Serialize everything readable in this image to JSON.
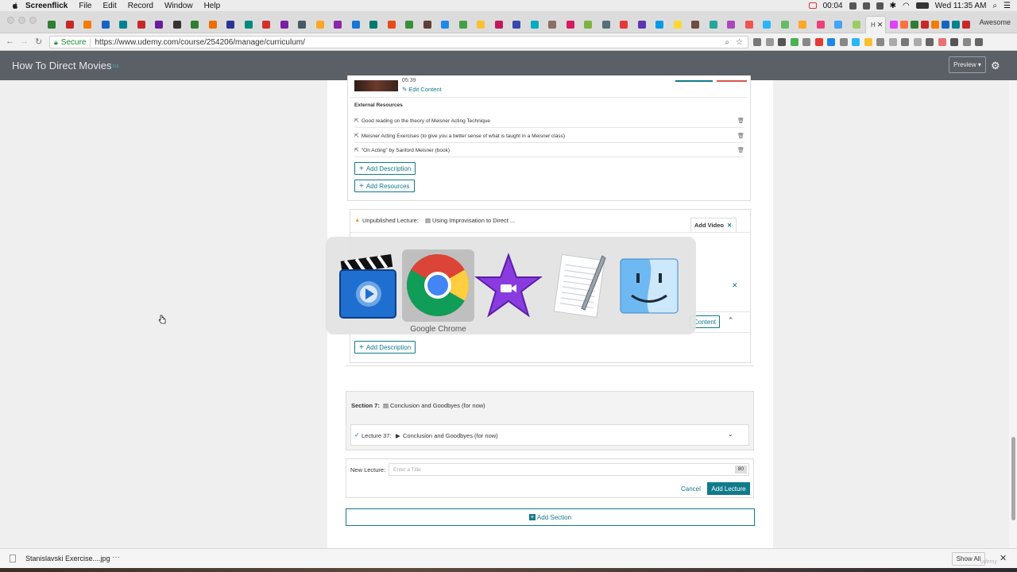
{
  "menubar": {
    "app_name": "Screenflick",
    "items": [
      "File",
      "Edit",
      "Record",
      "Window",
      "Help"
    ],
    "record_time": "00:04",
    "clock": "Wed 11:35 AM"
  },
  "browser": {
    "active_tab_title": "H",
    "profile_name": "Awesome",
    "secure_label": "Secure",
    "url": "https://www.udemy.com/course/254206/manage/curriculum/"
  },
  "app_header": {
    "course_title": "How To Direct Movies",
    "live_tag": "LIVE",
    "preview_label": "Preview ▾"
  },
  "top_lecture": {
    "duration": "05:39",
    "edit_content_label": "Edit Content",
    "external_resources_heading": "External Resources",
    "resources": [
      "Good reading on the theory of Meisner Acting Technique",
      "Meisner Acting Exercises (to give you a better sense of what is taught in a Meisner class)",
      "\"On Acting\" by Sanford Meisner (book)"
    ],
    "add_description_label": "Add Description",
    "add_resources_label": "Add Resources"
  },
  "unpublished_lecture": {
    "label": "Unpublished Lecture:",
    "title": "Using Improvisation to Direct ...",
    "add_video_label": "Add Video"
  },
  "partial_lecture": {
    "content_label": "Content",
    "add_description_label": "Add Description"
  },
  "section7": {
    "label": "Section 7:",
    "title": "Conclusion and Goodbyes (for now)",
    "lecture_label": "Lecture 37:",
    "lecture_title": "Conclusion and Goodbyes (for now)"
  },
  "new_lecture": {
    "label": "New Lecture:",
    "placeholder": "Enter a Title",
    "char_count": "80",
    "cancel_label": "Cancel",
    "add_lecture_label": "Add Lecture"
  },
  "add_section_label": "Add Section",
  "app_switcher": {
    "selected_app": "Google Chrome",
    "apps": [
      "screenflick-icon",
      "chrome-icon",
      "imovie-icon",
      "textedit-icon",
      "finder-icon"
    ]
  },
  "downloads": {
    "file_name": "Stanislavski Exercise....jpg",
    "more": "···",
    "show_all_label": "Show All"
  },
  "watermark": "udemy",
  "colors": {
    "teal": "#117a8b",
    "header_bg": "#5b5f66",
    "warning": "#e8a33d"
  }
}
